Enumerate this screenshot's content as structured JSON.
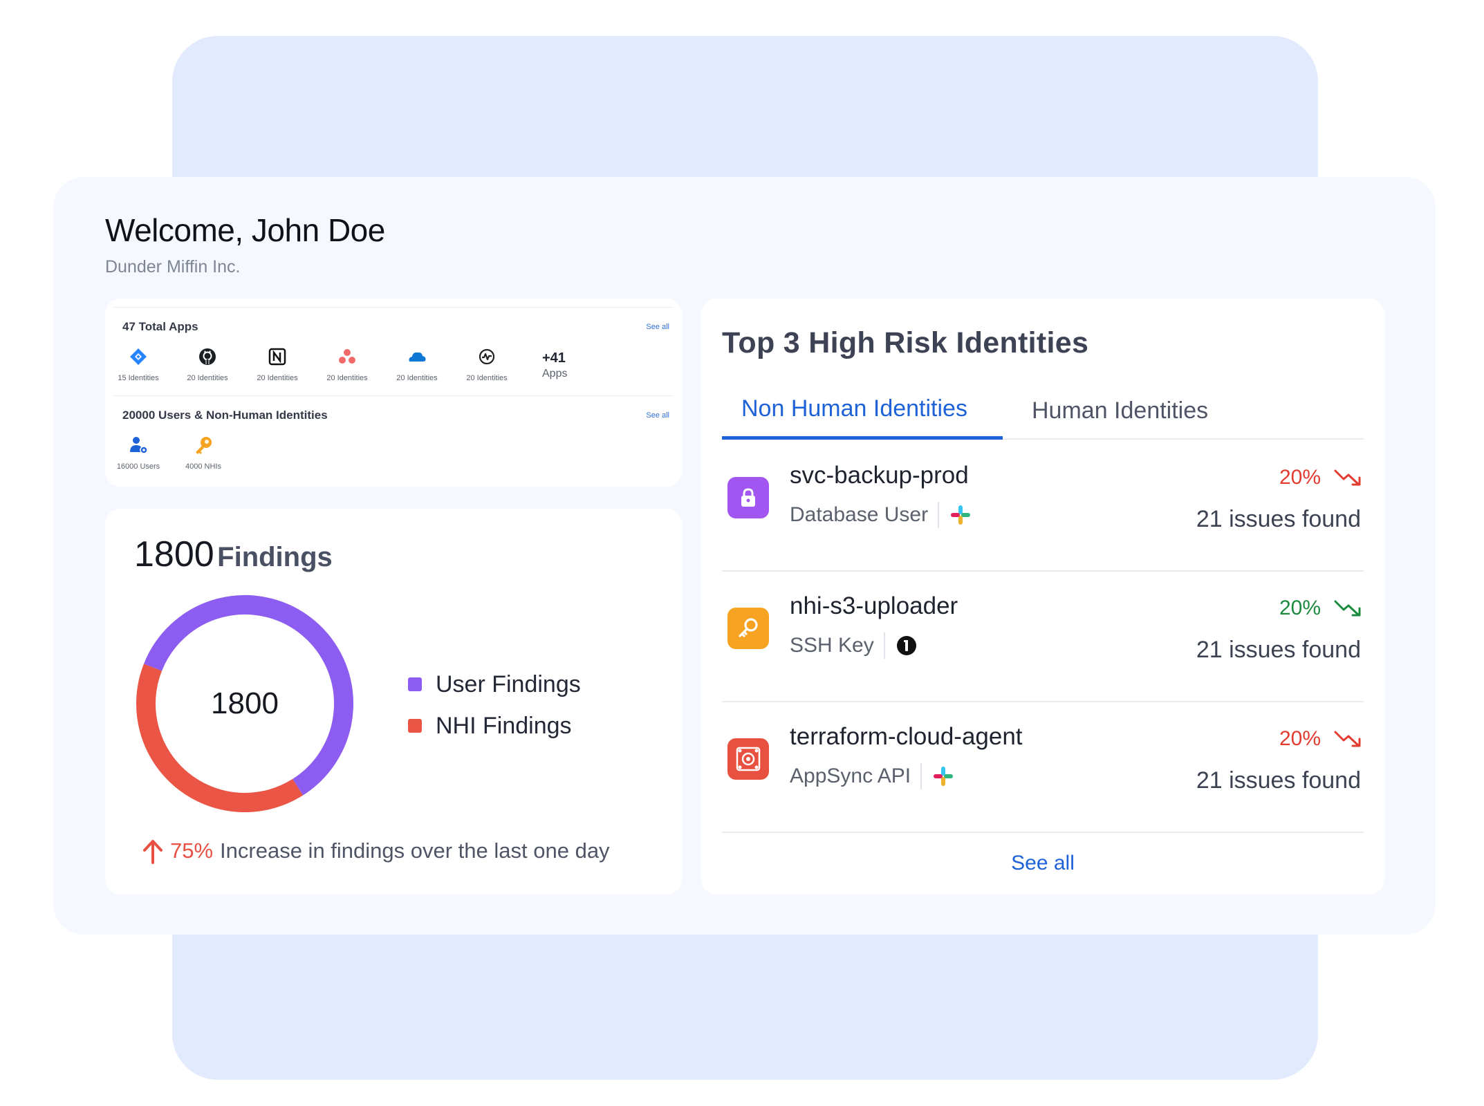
{
  "header": {
    "welcome": "Welcome, John Doe",
    "company": "Dunder Miffin Inc."
  },
  "apps": {
    "title": "47 Total Apps",
    "see_all": "See all",
    "items": [
      {
        "icon": "jira-icon",
        "label": "15 Identities"
      },
      {
        "icon": "github-icon",
        "label": "20 Identities"
      },
      {
        "icon": "notion-icon",
        "label": "20 Identities"
      },
      {
        "icon": "asana-icon",
        "label": "20 Identities"
      },
      {
        "icon": "onedrive-icon",
        "label": "20 Identities"
      },
      {
        "icon": "heartbeat-icon",
        "label": "20 Identities"
      }
    ],
    "more_count": "+41",
    "more_label": "Apps"
  },
  "identities": {
    "title": "20000 Users & Non-Human Identities",
    "see_all": "See all",
    "items": [
      {
        "icon": "users-icon",
        "label": "16000 Users"
      },
      {
        "icon": "nhi-key-icon",
        "label": "4000 NHIs"
      }
    ]
  },
  "findings": {
    "total": "1800",
    "word": "Findings",
    "center": "1800",
    "legend": [
      {
        "label": "User Findings",
        "color": "#8d5cf0"
      },
      {
        "label": "NHI Findings",
        "color": "#ea5545"
      }
    ],
    "increase_pct": "75%",
    "increase_text": "Increase in findings over the last one day"
  },
  "chart_data": {
    "type": "pie",
    "categories": [
      "User Findings",
      "NHI Findings"
    ],
    "values": [
      1080,
      720
    ],
    "colors": [
      "#8d5cf0",
      "#ea5545"
    ],
    "title": "",
    "legend": "right"
  },
  "risk": {
    "title": "Top 3 High Risk Identities",
    "tabs": [
      {
        "label": "Non Human Identities",
        "active": true
      },
      {
        "label": "Human Identities",
        "active": false
      }
    ],
    "rows": [
      {
        "name": "svc-backup-prod",
        "type": "Database User",
        "icon": "lock-icon",
        "icon_color": "#a155f1",
        "source_icon": "slack-icon",
        "pct": "20%",
        "pct_color": "#e23c30",
        "trend": "trend-down-red-icon",
        "issues": "21 issues found"
      },
      {
        "name": "nhi-s3-uploader",
        "type": "SSH Key",
        "icon": "key-icon",
        "icon_color": "#f5a320",
        "source_icon": "onepassword-icon",
        "pct": "20%",
        "pct_color": "#1c8a3f",
        "trend": "trend-down-green-icon",
        "issues": "21 issues found"
      },
      {
        "name": "terraform-cloud-agent",
        "type": "AppSync API",
        "icon": "api-icon",
        "icon_color": "#e8513f",
        "source_icon": "slack-icon",
        "pct": "20%",
        "pct_color": "#e23c30",
        "trend": "trend-down-red-icon",
        "issues": "21 issues found"
      }
    ],
    "see_all": "See all"
  }
}
